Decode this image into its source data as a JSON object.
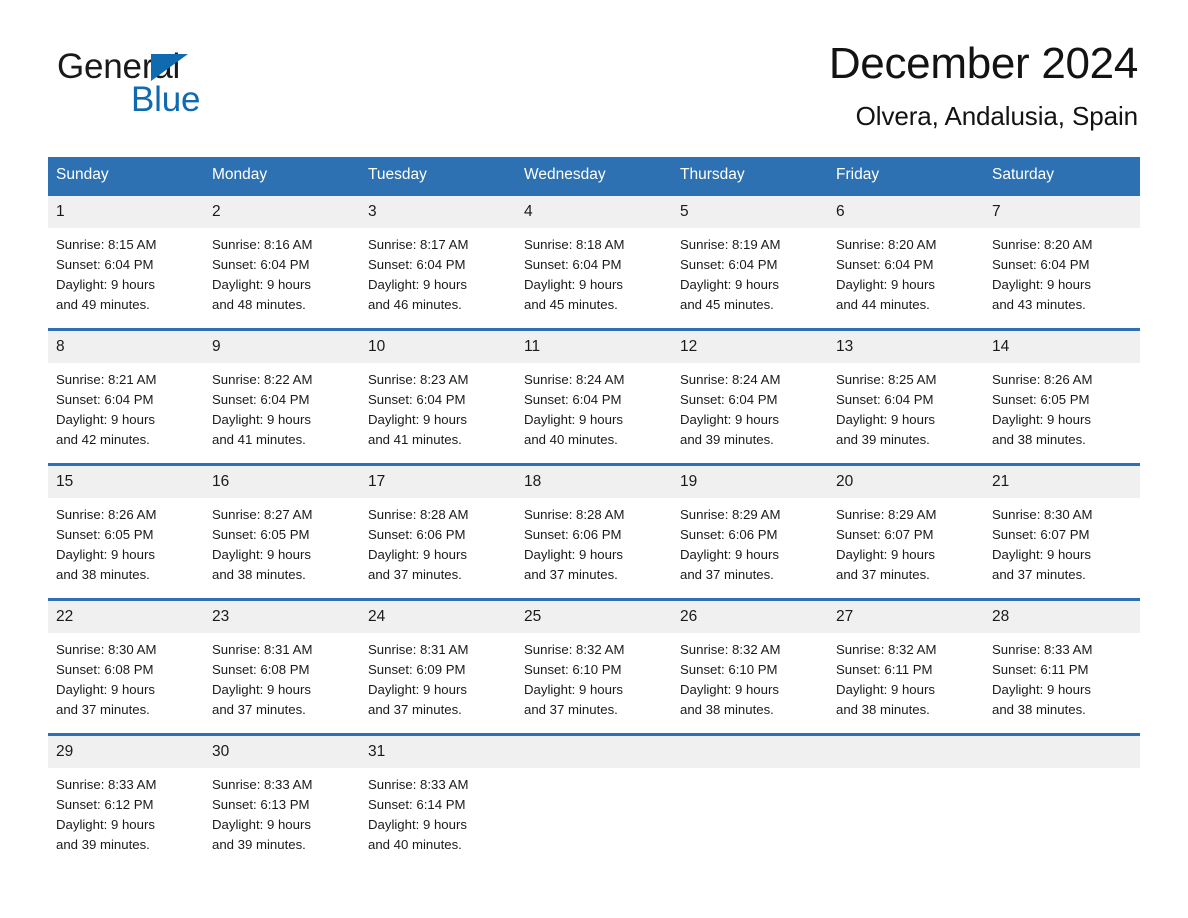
{
  "brand": {
    "name_part1": "General",
    "name_part2": "Blue",
    "flag_color": "#0f6ab0"
  },
  "header": {
    "month_title": "December 2024",
    "location": "Olvera, Andalusia, Spain"
  },
  "theme": {
    "header_blue": "#2d71b2",
    "daynum_bg": "#f0f0f0",
    "text": "#1a1a1a"
  },
  "calendar": {
    "weekday_headers": [
      "Sunday",
      "Monday",
      "Tuesday",
      "Wednesday",
      "Thursday",
      "Friday",
      "Saturday"
    ],
    "weeks": [
      [
        {
          "day": "1",
          "info": "Sunrise: 8:15 AM\nSunset: 6:04 PM\nDaylight: 9 hours\nand 49 minutes."
        },
        {
          "day": "2",
          "info": "Sunrise: 8:16 AM\nSunset: 6:04 PM\nDaylight: 9 hours\nand 48 minutes."
        },
        {
          "day": "3",
          "info": "Sunrise: 8:17 AM\nSunset: 6:04 PM\nDaylight: 9 hours\nand 46 minutes."
        },
        {
          "day": "4",
          "info": "Sunrise: 8:18 AM\nSunset: 6:04 PM\nDaylight: 9 hours\nand 45 minutes."
        },
        {
          "day": "5",
          "info": "Sunrise: 8:19 AM\nSunset: 6:04 PM\nDaylight: 9 hours\nand 45 minutes."
        },
        {
          "day": "6",
          "info": "Sunrise: 8:20 AM\nSunset: 6:04 PM\nDaylight: 9 hours\nand 44 minutes."
        },
        {
          "day": "7",
          "info": "Sunrise: 8:20 AM\nSunset: 6:04 PM\nDaylight: 9 hours\nand 43 minutes."
        }
      ],
      [
        {
          "day": "8",
          "info": "Sunrise: 8:21 AM\nSunset: 6:04 PM\nDaylight: 9 hours\nand 42 minutes."
        },
        {
          "day": "9",
          "info": "Sunrise: 8:22 AM\nSunset: 6:04 PM\nDaylight: 9 hours\nand 41 minutes."
        },
        {
          "day": "10",
          "info": "Sunrise: 8:23 AM\nSunset: 6:04 PM\nDaylight: 9 hours\nand 41 minutes."
        },
        {
          "day": "11",
          "info": "Sunrise: 8:24 AM\nSunset: 6:04 PM\nDaylight: 9 hours\nand 40 minutes."
        },
        {
          "day": "12",
          "info": "Sunrise: 8:24 AM\nSunset: 6:04 PM\nDaylight: 9 hours\nand 39 minutes."
        },
        {
          "day": "13",
          "info": "Sunrise: 8:25 AM\nSunset: 6:04 PM\nDaylight: 9 hours\nand 39 minutes."
        },
        {
          "day": "14",
          "info": "Sunrise: 8:26 AM\nSunset: 6:05 PM\nDaylight: 9 hours\nand 38 minutes."
        }
      ],
      [
        {
          "day": "15",
          "info": "Sunrise: 8:26 AM\nSunset: 6:05 PM\nDaylight: 9 hours\nand 38 minutes."
        },
        {
          "day": "16",
          "info": "Sunrise: 8:27 AM\nSunset: 6:05 PM\nDaylight: 9 hours\nand 38 minutes."
        },
        {
          "day": "17",
          "info": "Sunrise: 8:28 AM\nSunset: 6:06 PM\nDaylight: 9 hours\nand 37 minutes."
        },
        {
          "day": "18",
          "info": "Sunrise: 8:28 AM\nSunset: 6:06 PM\nDaylight: 9 hours\nand 37 minutes."
        },
        {
          "day": "19",
          "info": "Sunrise: 8:29 AM\nSunset: 6:06 PM\nDaylight: 9 hours\nand 37 minutes."
        },
        {
          "day": "20",
          "info": "Sunrise: 8:29 AM\nSunset: 6:07 PM\nDaylight: 9 hours\nand 37 minutes."
        },
        {
          "day": "21",
          "info": "Sunrise: 8:30 AM\nSunset: 6:07 PM\nDaylight: 9 hours\nand 37 minutes."
        }
      ],
      [
        {
          "day": "22",
          "info": "Sunrise: 8:30 AM\nSunset: 6:08 PM\nDaylight: 9 hours\nand 37 minutes."
        },
        {
          "day": "23",
          "info": "Sunrise: 8:31 AM\nSunset: 6:08 PM\nDaylight: 9 hours\nand 37 minutes."
        },
        {
          "day": "24",
          "info": "Sunrise: 8:31 AM\nSunset: 6:09 PM\nDaylight: 9 hours\nand 37 minutes."
        },
        {
          "day": "25",
          "info": "Sunrise: 8:32 AM\nSunset: 6:10 PM\nDaylight: 9 hours\nand 37 minutes."
        },
        {
          "day": "26",
          "info": "Sunrise: 8:32 AM\nSunset: 6:10 PM\nDaylight: 9 hours\nand 38 minutes."
        },
        {
          "day": "27",
          "info": "Sunrise: 8:32 AM\nSunset: 6:11 PM\nDaylight: 9 hours\nand 38 minutes."
        },
        {
          "day": "28",
          "info": "Sunrise: 8:33 AM\nSunset: 6:11 PM\nDaylight: 9 hours\nand 38 minutes."
        }
      ],
      [
        {
          "day": "29",
          "info": "Sunrise: 8:33 AM\nSunset: 6:12 PM\nDaylight: 9 hours\nand 39 minutes."
        },
        {
          "day": "30",
          "info": "Sunrise: 8:33 AM\nSunset: 6:13 PM\nDaylight: 9 hours\nand 39 minutes."
        },
        {
          "day": "31",
          "info": "Sunrise: 8:33 AM\nSunset: 6:14 PM\nDaylight: 9 hours\nand 40 minutes."
        },
        {
          "day": "",
          "info": ""
        },
        {
          "day": "",
          "info": ""
        },
        {
          "day": "",
          "info": ""
        },
        {
          "day": "",
          "info": ""
        }
      ]
    ]
  }
}
